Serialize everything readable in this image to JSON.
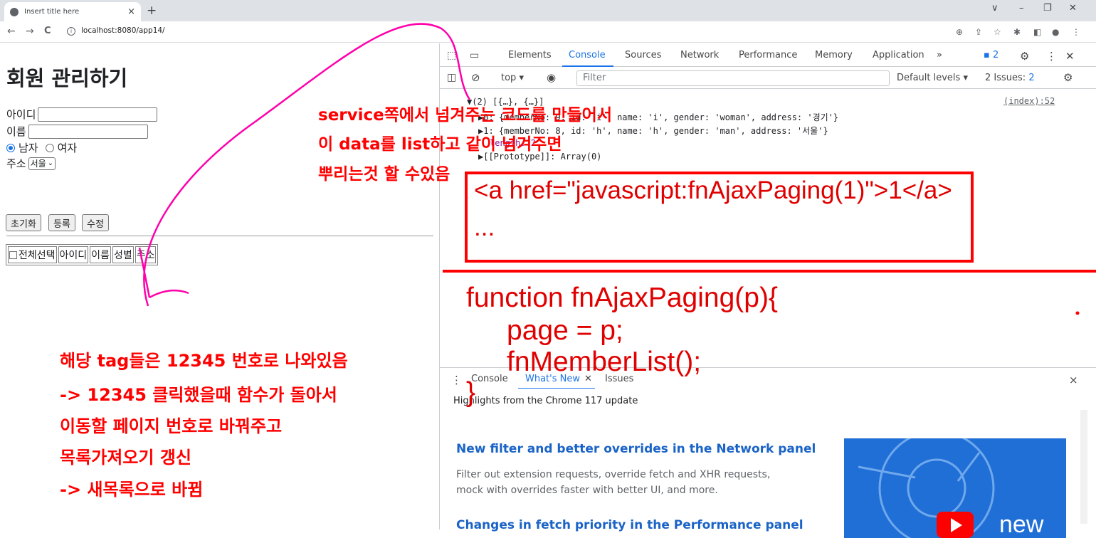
{
  "browser": {
    "tab_title": "Insert title here",
    "tab_close": "×",
    "new_tab": "+",
    "url": "localhost:8080/app14/",
    "nav_back": "←",
    "nav_forward": "→",
    "nav_reload": "C",
    "win_controls": [
      "∨",
      "–",
      "❐",
      "✕"
    ]
  },
  "page": {
    "title": "회원 관리하기",
    "id_label": "아이디",
    "name_label": "이름",
    "gender_male": "남자",
    "gender_female": "여자",
    "address_label": "주소",
    "address_selected": "서울",
    "buttons": {
      "reset": "초기화",
      "register": "등록",
      "modify": "수정"
    },
    "table_headers": [
      "전체선택",
      "아이디",
      "이름",
      "성별",
      "주소"
    ]
  },
  "devtools": {
    "tabs": [
      "Elements",
      "Console",
      "Sources",
      "Network",
      "Performance",
      "Memory",
      "Application"
    ],
    "more_tabs": "»",
    "issue_count_top": "2",
    "context": "top",
    "filter_placeholder": "Filter",
    "levels": "Default levels",
    "issues_label": "2 Issues:",
    "issues_count": "2",
    "console_lines": [
      "▼(2) [{…}, {…}]",
      "▶0: {memberNo: 9, id: 'i', name: 'i', gender: 'woman', address: '경기'}",
      "▶1: {memberNo: 8, id: 'h', name: 'h', gender: 'man', address: '서울'}",
      "length: 2",
      "▶[[Prototype]]: Array(0)"
    ],
    "source_link": "(index):52",
    "drawer_tabs": [
      "Console",
      "What's New",
      "Issues"
    ],
    "drawer_close": "×",
    "highlights": "Highlights from the Chrome 117 update",
    "article1_title": "New filter and better overrides in the Network panel",
    "article1_desc": "Filter out extension requests, override fetch and XHR requests, mock with overrides faster with better UI, and more.",
    "article2_title": "Changes in fetch priority in the Performance panel",
    "thumb_label": "new"
  },
  "annotations": {
    "top_note": [
      "service쪽에서 넘겨주는 코드를 만들어서",
      "이 data를 list하고 같이 넘겨주면",
      "뿌리는것 할 수있음"
    ],
    "boxed_code": [
      "<a href=\"javascript:fnAjaxPaging(1)\">1</a>",
      "..."
    ],
    "function_code": [
      "function fnAjaxPaging(p){",
      "page = p;",
      "fnMemberList();",
      "}"
    ],
    "bottom_note": [
      "해당 tag들은 12345 번호로 나와있음",
      "-> 12345 클릭했을때 함수가 돌아서",
      "이동할 페이지 번호로 바꿔주고",
      "목록가져오기 갱신",
      "-> 새목록으로 바뀜"
    ],
    "colors": {
      "annotation": "#ff0000",
      "arrow": "#ff00aa",
      "link": "#1a73e8"
    }
  }
}
